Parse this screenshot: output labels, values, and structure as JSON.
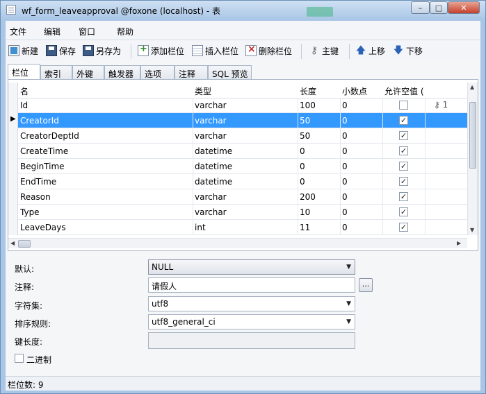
{
  "window": {
    "title": "wf_form_leaveapproval @foxone (localhost) - 表"
  },
  "titlebar_buttons": {
    "min": "–",
    "max": "□",
    "close": "✕"
  },
  "menu": [
    "文件",
    "编辑",
    "窗口",
    "帮助"
  ],
  "toolbar": {
    "new": "新建",
    "save": "保存",
    "save_as": "另存为",
    "add_column": "添加栏位",
    "insert_column": "插入栏位",
    "delete_column": "删除栏位",
    "primary_key": "主键",
    "move_up": "上移",
    "move_down": "下移"
  },
  "tabs": [
    "栏位",
    "索引",
    "外键",
    "触发器",
    "选项",
    "注释",
    "SQL 预览"
  ],
  "grid": {
    "headers": [
      "名",
      "类型",
      "长度",
      "小数点",
      "允许空值 (",
      ""
    ],
    "rows": [
      {
        "name": "Id",
        "type": "varchar",
        "length": "100",
        "decimals": "0",
        "nullable": false,
        "key": "1",
        "selected": false
      },
      {
        "name": "CreatorId",
        "type": "varchar",
        "length": "50",
        "decimals": "0",
        "nullable": true,
        "key": "",
        "selected": true
      },
      {
        "name": "CreatorDeptId",
        "type": "varchar",
        "length": "50",
        "decimals": "0",
        "nullable": true,
        "key": "",
        "selected": false
      },
      {
        "name": "CreateTime",
        "type": "datetime",
        "length": "0",
        "decimals": "0",
        "nullable": true,
        "key": "",
        "selected": false
      },
      {
        "name": "BeginTime",
        "type": "datetime",
        "length": "0",
        "decimals": "0",
        "nullable": true,
        "key": "",
        "selected": false
      },
      {
        "name": "EndTime",
        "type": "datetime",
        "length": "0",
        "decimals": "0",
        "nullable": true,
        "key": "",
        "selected": false
      },
      {
        "name": "Reason",
        "type": "varchar",
        "length": "200",
        "decimals": "0",
        "nullable": true,
        "key": "",
        "selected": false
      },
      {
        "name": "Type",
        "type": "varchar",
        "length": "10",
        "decimals": "0",
        "nullable": true,
        "key": "",
        "selected": false
      },
      {
        "name": "LeaveDays",
        "type": "int",
        "length": "11",
        "decimals": "0",
        "nullable": true,
        "key": "",
        "selected": false
      }
    ]
  },
  "props": {
    "default_label": "默认:",
    "default_value": "NULL",
    "comment_label": "注释:",
    "comment_value": "请假人",
    "comment_button": "...",
    "charset_label": "字符集:",
    "charset_value": "utf8",
    "collation_label": "排序规则:",
    "collation_value": "utf8_general_ci",
    "keylength_label": "键长度:",
    "keylength_value": "",
    "binary_label": "二进制",
    "binary_checked": false
  },
  "status": {
    "text": "栏位数: 9"
  },
  "colors": {
    "selection": "#3399ff",
    "titlebar": "#a9c6e6",
    "close_button": "#c5412b"
  }
}
